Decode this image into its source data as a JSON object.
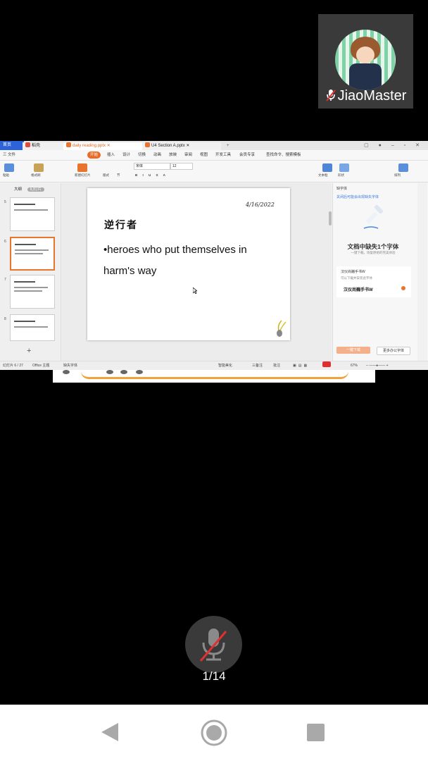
{
  "participant": {
    "name": "JiaoMaster",
    "mic_state": "muted"
  },
  "screen_share": {
    "tabs": [
      {
        "label": "首页",
        "active": false
      },
      {
        "label": "稻壳",
        "active": false
      },
      {
        "label": "daily reading.pptx",
        "active": true
      },
      {
        "label": "U4 Section A.pptx",
        "active": false
      }
    ],
    "menus": [
      "三 文件",
      "开始",
      "插入",
      "设计",
      "切换",
      "动画",
      "放映",
      "审阅",
      "视图",
      "开发工具",
      "会员专享",
      "查找命令、搜索模板"
    ],
    "active_menu": "开始",
    "toolbar": {
      "font_name": "宋体",
      "font_size": "12",
      "labels": [
        "粘贴",
        "格式刷",
        "新建幻灯片",
        "版式",
        "节",
        "文本框",
        "形状",
        "排列"
      ]
    },
    "thumbnail_panel": {
      "tabs": [
        "大纲",
        "幻灯片"
      ],
      "active_tab": "幻灯片",
      "slides": [
        {
          "number": "5",
          "selected": false
        },
        {
          "number": "6",
          "selected": true
        },
        {
          "number": "7",
          "selected": false
        },
        {
          "number": "8",
          "selected": false
        }
      ],
      "add_label": "+"
    },
    "slide": {
      "date": "4/16/2022",
      "title": "逆行者",
      "body": "•heroes who put themselves in harm's way"
    },
    "right_panel": {
      "header": "缺字体",
      "link": "关闭后可能会出现缺失字体",
      "title": "文档中缺失1个字体",
      "subtitle": "一键下载，恢复原始的完美体验",
      "card_line1": "汉仪尚巍手书W",
      "card_line2": "可以下载并安装此字体",
      "card_font": "汉仪尚巍手书W",
      "primary_button": "一键下载",
      "secondary_button": "更多办公字体"
    },
    "status_bar": {
      "slide_counter": "幻灯片 6 / 27",
      "theme": "Office 主题",
      "missing_fonts": "缺失字体",
      "smart_beautify": "智能美化",
      "notes": "三备注",
      "comments": "批注",
      "zoom": "67%"
    }
  },
  "page_indicator": "1/14"
}
